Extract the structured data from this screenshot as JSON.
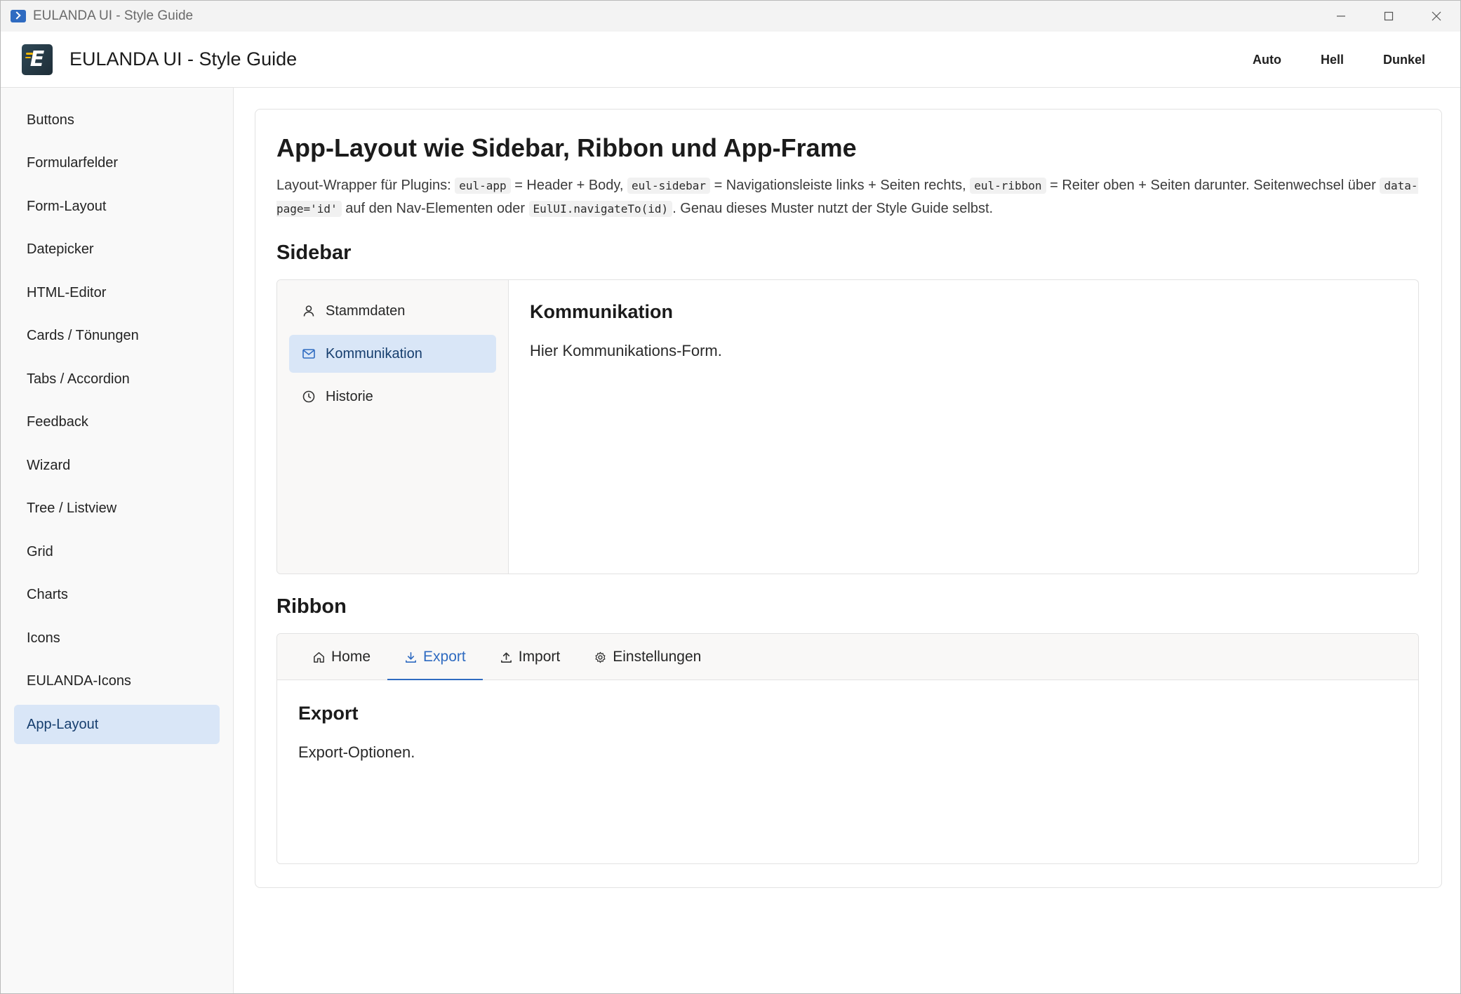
{
  "window": {
    "title": "EULANDA UI - Style Guide"
  },
  "header": {
    "app_title": "EULANDA UI - Style Guide",
    "logo_letter": "E",
    "theme_buttons": [
      "Auto",
      "Hell",
      "Dunkel"
    ]
  },
  "nav": {
    "items": [
      "Buttons",
      "Formularfelder",
      "Form-Layout",
      "Datepicker",
      "HTML-Editor",
      "Cards / Tönungen",
      "Tabs / Accordion",
      "Feedback",
      "Wizard",
      "Tree / Listview",
      "Grid",
      "Charts",
      "Icons",
      "EULANDA-Icons",
      "App-Layout"
    ],
    "active": "App-Layout"
  },
  "page": {
    "title": "App-Layout wie Sidebar, Ribbon und App-Frame",
    "desc": {
      "t1": "Layout-Wrapper für Plugins: ",
      "c1": "eul-app",
      "t2": " = Header + Body, ",
      "c2": "eul-sidebar",
      "t3": " = Navigationsleiste links + Seiten rechts, ",
      "c3": "eul-ribbon",
      "t4": " = Reiter oben + Seiten darunter. Seitenwechsel über ",
      "c4": "data-page='id'",
      "t5": " auf den Nav-Elementen oder ",
      "c5": "EulUI.navigateTo(id)",
      "t6": ". Genau dieses Muster nutzt der Style Guide selbst."
    },
    "sidebar_heading": "Sidebar",
    "sidebar_demo": {
      "items": [
        {
          "label": "Stammdaten",
          "icon": "person-icon"
        },
        {
          "label": "Kommunikation",
          "icon": "mail-icon"
        },
        {
          "label": "Historie",
          "icon": "clock-icon"
        }
      ],
      "active": "Kommunikation",
      "content_title": "Kommunikation",
      "content_body": "Hier Kommunikations-Form."
    },
    "ribbon_heading": "Ribbon",
    "ribbon_demo": {
      "tabs": [
        {
          "label": "Home",
          "icon": "home-icon"
        },
        {
          "label": "Export",
          "icon": "download-icon"
        },
        {
          "label": "Import",
          "icon": "upload-icon"
        },
        {
          "label": "Einstellungen",
          "icon": "gear-icon"
        }
      ],
      "active": "Export",
      "content_title": "Export",
      "content_body": "Export-Optionen."
    }
  },
  "colors": {
    "accent": "#2f6bc1",
    "active_bg": "#d9e6f7",
    "active_text": "#163e6e"
  }
}
